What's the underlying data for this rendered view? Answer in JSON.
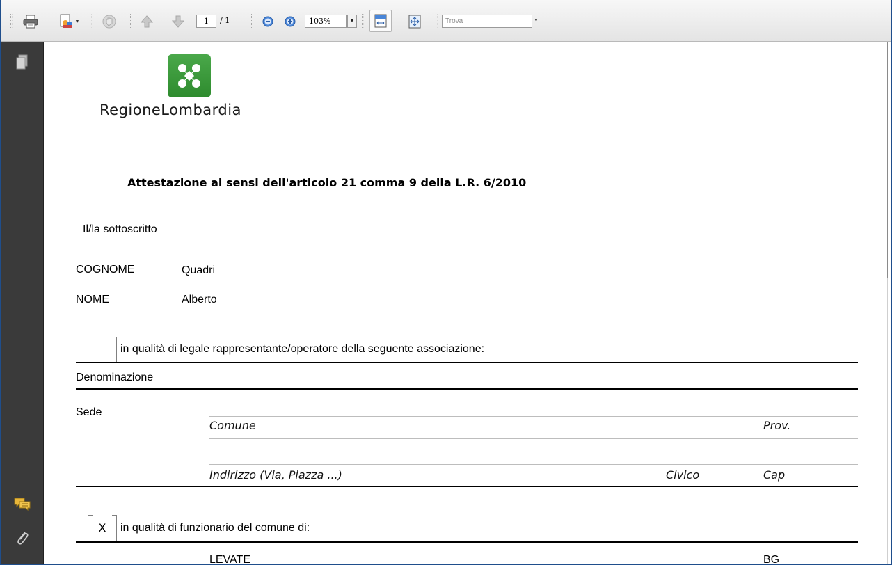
{
  "toolbar": {
    "page_current": "1",
    "page_total": "/ 1",
    "zoom_value": "103%",
    "find_placeholder": "Trova",
    "icons": [
      "print-icon",
      "review-icon",
      "hand-icon",
      "prev-page-icon",
      "next-page-icon",
      "zoom-out-icon",
      "zoom-in-icon",
      "fit-width-icon",
      "fit-page-icon"
    ]
  },
  "leftnav": {
    "icons": [
      "pages-icon",
      "comments-icon",
      "attachments-icon"
    ]
  },
  "document": {
    "brand": "RegioneLombardia",
    "logo_color": "#2e8b2e",
    "title": "Attestazione ai sensi dell'articolo 21 comma 9 della L.R. 6/2010",
    "intro": "Il/la sottoscritto",
    "fields": [
      {
        "label": "COGNOME",
        "value": "Quadri"
      },
      {
        "label": "NOME",
        "value": "Alberto"
      }
    ],
    "option_association": {
      "checked_mark": "",
      "text": "in qualità di legale rappresentante/operatore della seguente associazione:"
    },
    "denominazione_label": "Denominazione",
    "sede_label": "Sede",
    "comune_label": "Comune",
    "prov_label": "Prov.",
    "indirizzo_label": "Indirizzo (Via, Piazza ...)",
    "civico_label": "Civico",
    "cap_label": "Cap",
    "option_comune": {
      "checked_mark": "X",
      "text": "in qualità di funzionario del comune di:"
    },
    "comune_value": "LEVATE",
    "prov_value": "BG"
  }
}
